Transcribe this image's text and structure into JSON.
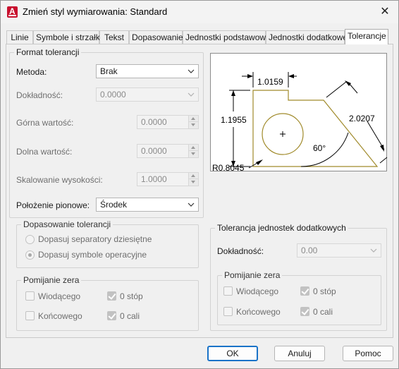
{
  "window": {
    "title": "Zmień styl wymiarowania: Standard",
    "app_icon_letter": "A",
    "close_glyph": "✕"
  },
  "tabs": [
    {
      "label": "Linie"
    },
    {
      "label": "Symbole i strzałki"
    },
    {
      "label": "Tekst"
    },
    {
      "label": "Dopasowanie"
    },
    {
      "label": "Jednostki podstawowe"
    },
    {
      "label": "Jednostki dodatkowe"
    },
    {
      "label": "Tolerancje",
      "active": true
    }
  ],
  "format": {
    "legend": "Format tolerancji",
    "method_label": "Metoda:",
    "method_value": "Brak",
    "precision_label": "Dokładność:",
    "precision_value": "0.0000",
    "upper_label": "Górna wartość:",
    "upper_value": "0.0000",
    "lower_label": "Dolna wartość:",
    "lower_value": "0.0000",
    "scale_label": "Skalowanie wysokości:",
    "scale_value": "1.0000",
    "vpos_label": "Położenie pionowe:",
    "vpos_value": "Środek"
  },
  "alignment": {
    "legend": "Dopasowanie tolerancji",
    "opt1": "Dopasuj separatory dziesiętne",
    "opt2": "Dopasuj symbole operacyjne"
  },
  "zero_left": {
    "legend": "Pomijanie zera",
    "leading": "Wiodącego",
    "trailing": "Końcowego",
    "feet": "0 stóp",
    "inches": "0 cali"
  },
  "alt_units": {
    "legend": "Tolerancja jednostek dodatkowych",
    "precision_label": "Dokładność:",
    "precision_value": "0.00"
  },
  "zero_right": {
    "legend": "Pomijanie zera",
    "leading": "Wiodącego",
    "trailing": "Końcowego",
    "feet": "0 stóp",
    "inches": "0 cali"
  },
  "preview": {
    "dim_top": "1.0159",
    "dim_left": "1.1955",
    "dim_right": "2.0207",
    "angle": "60°",
    "radius": "R0.8045",
    "shape_color": "#a08a2a"
  },
  "buttons": {
    "ok": "OK",
    "cancel": "Anuluj",
    "help": "Pomoc"
  },
  "colors": {
    "accent": "#1a73c8",
    "app_icon": "#c8102e"
  }
}
